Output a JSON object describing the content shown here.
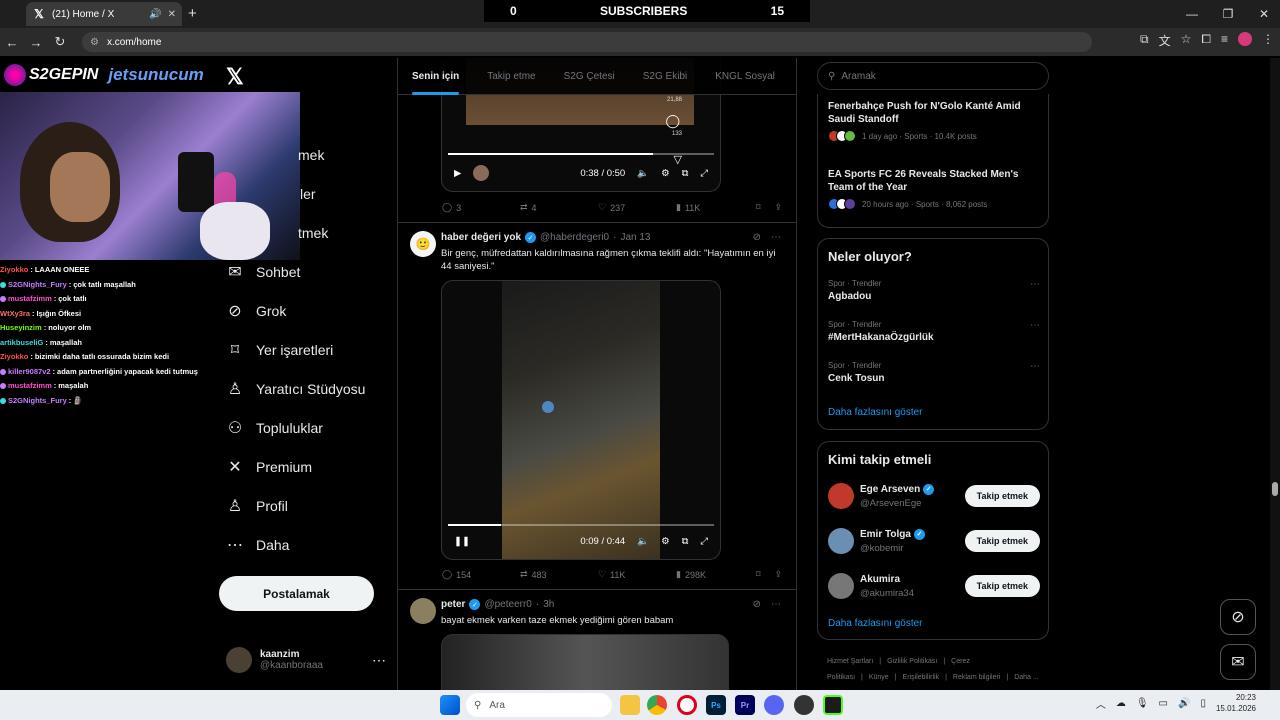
{
  "browser": {
    "tab_title": "(21) Home / X",
    "url": "x.com/home",
    "subscribers": {
      "left": "0",
      "label": "SUBSCRIBERS",
      "right": "15"
    }
  },
  "overlay": {
    "logo1": "S2GEPIN",
    "logo2": "jetsunucum",
    "chat": [
      {
        "user": "Ziyokko",
        "msg": "LAAAN ONEEE",
        "color": "#ff4d4d",
        "badge": ""
      },
      {
        "user": "S2GNights_Fury",
        "msg": "çok tatlı maşallah",
        "color": "#c77dff",
        "badge": "#3ddbd9"
      },
      {
        "user": "mustafzimm",
        "msg": "çok tatlı",
        "color": "#ff4dd2",
        "badge": "#c77dff"
      },
      {
        "user": "WtXy3ra",
        "msg": "Işığın Öfkesi",
        "color": "#ff6b6b",
        "badge": ""
      },
      {
        "user": "Huseyinzim",
        "msg": "noluyor olm",
        "color": "#7CFC00",
        "badge": ""
      },
      {
        "user": "artikbuseliG",
        "msg": "maşallah",
        "color": "#3ddbd9",
        "badge": ""
      },
      {
        "user": "Ziyokko",
        "msg": "bizimki daha tatlı ossurada bizim kedi",
        "color": "#ff4d4d",
        "badge": ""
      },
      {
        "user": "killer9087v2",
        "msg": "adam partnerliğini yapacak kedi tutmuş",
        "color": "#c77dff",
        "badge": "#c77dff"
      },
      {
        "user": "mustafzimm",
        "msg": "maşalah",
        "color": "#ff4dd2",
        "badge": "#c77dff"
      },
      {
        "user": "S2GNights_Fury",
        "msg": "🗿",
        "color": "#c77dff",
        "badge": "#3ddbd9"
      }
    ]
  },
  "nav": {
    "partial": [
      "mek",
      "ler",
      "tmek"
    ],
    "items": [
      {
        "label": "Sohbet",
        "icon": "✉"
      },
      {
        "label": "Grok",
        "icon": "⊘"
      },
      {
        "label": "Yer işaretleri",
        "icon": "⌑"
      },
      {
        "label": "Yaratıcı Stüdyosu",
        "icon": "♙"
      },
      {
        "label": "Topluluklar",
        "icon": "⚇"
      },
      {
        "label": "Premium",
        "icon": "✕"
      },
      {
        "label": "Profil",
        "icon": "♙"
      },
      {
        "label": "Daha",
        "icon": "⋯"
      }
    ],
    "post_button": "Postalamak",
    "account": {
      "name": "kaanzim",
      "handle": "@kaanboraaa"
    }
  },
  "feed": {
    "tabs": [
      "Senin için",
      "Takip etme",
      "S2G Çetesi",
      "S2G Ekibi",
      "KNGL Sosyal"
    ],
    "video1": {
      "time": "0:38 / 0:50",
      "side_count1": "21,88",
      "side_count2": "133",
      "progress": 0.77
    },
    "post1_actions": {
      "reply": "3",
      "repost": "4",
      "like": "237",
      "views": "11K"
    },
    "post2": {
      "name": "haber değeri yok",
      "handle": "@haberdegeri0",
      "date": "Jan 13",
      "text": "Bir genç, müfredattan kaldırılmasına rağmen çıkma teklifi aldı: \"Hayatımın en iyi 44 saniyesi.\"",
      "time": "0:09 / 0:44",
      "progress": 0.2,
      "actions": {
        "reply": "154",
        "repost": "483",
        "like": "11K",
        "views": "298K"
      }
    },
    "post3": {
      "name": "peter",
      "handle": "@peteerr0",
      "date": "3h",
      "text": "bayat ekmek varken taze ekmek yediğimi gören babam"
    }
  },
  "right": {
    "search_placeholder": "Aramak",
    "news": [
      {
        "title": "Fenerbahçe Push for N'Golo Kanté Amid Saudi Standoff",
        "meta": "1 day ago · Sports · 10.4K posts"
      },
      {
        "title": "EA Sports FC 26 Reveals Stacked Men's Team of the Year",
        "meta": "20 hours ago · Sports · 8,062 posts"
      }
    ],
    "trends_title": "Neler oluyor?",
    "trends": [
      {
        "category": "Spor · Trendler",
        "name": "Agbadou"
      },
      {
        "category": "Spor · Trendler",
        "name": "#MertHakanaÖzgürlük"
      },
      {
        "category": "Spor · Trendler",
        "name": "Cenk Tosun"
      }
    ],
    "show_more": "Daha fazlasını göster",
    "who_title": "Kimi takip etmeli",
    "who": [
      {
        "name": "Ege Arseven",
        "handle": "@ArsevenEge",
        "button": "Takip etmek",
        "color": "#c0392b"
      },
      {
        "name": "Emir Tolga",
        "handle": "@kobemir",
        "button": "Takip etmek",
        "color": "#6b8fb3"
      },
      {
        "name": "Akumira",
        "handle": "@akumira34",
        "button": "Takip etmek",
        "color": "#777"
      }
    ],
    "show_more2": "Daha fazlasını göster",
    "footer": [
      "Hizmet Şartları",
      "Gizlilik Politikası",
      "Çerez Politikası",
      "Künye",
      "Erişilebilirlik",
      "Reklam bilgileri",
      "Daha ..."
    ]
  },
  "taskbar": {
    "search": "Ara",
    "time": "20:23",
    "date": "15.01.2026"
  }
}
